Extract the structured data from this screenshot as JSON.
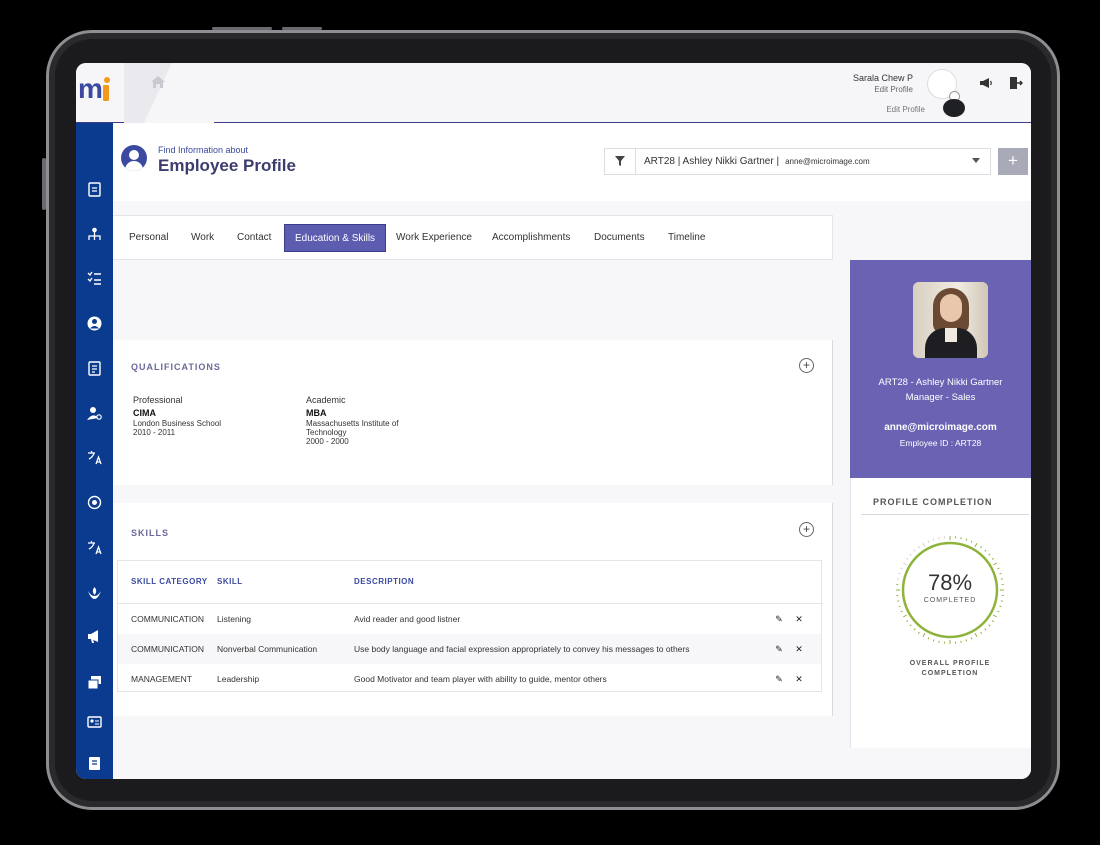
{
  "header": {
    "user_name": "Sarala Chew P",
    "edit_profile": "Edit Profile",
    "edit_profile_echo": "Edit Profile"
  },
  "page": {
    "subtitle": "Find Information about",
    "title": "Employee Profile"
  },
  "employee_select": {
    "value": "ART28 | Ashley Nikki Gartner |",
    "email": "anne@microimage.com",
    "add_label": "+"
  },
  "tabs": [
    {
      "label": "Personal"
    },
    {
      "label": "Work"
    },
    {
      "label": "Contact"
    },
    {
      "label": "Education & Skills",
      "active": true
    },
    {
      "label": "Work Experience"
    },
    {
      "label": "Accomplishments"
    },
    {
      "label": "Documents"
    },
    {
      "label": "Timeline"
    }
  ],
  "qualifications": {
    "title": "QUALIFICATIONS",
    "add_label": "+",
    "items": [
      {
        "type": "Professional",
        "degree": "CIMA",
        "institution": "London Business School",
        "years": "2010 - 2011"
      },
      {
        "type": "Academic",
        "degree": "MBA",
        "institution": "Massachusetts Institute of Technology",
        "years": "2000 - 2000"
      }
    ]
  },
  "skills": {
    "title": "SKILLS",
    "add_label": "+",
    "columns": [
      "SKILL CATEGORY",
      "SKILL",
      "DESCRIPTION"
    ],
    "rows": [
      {
        "category": "COMMUNICATION",
        "skill": "Listening",
        "description": "Avid reader and good listner"
      },
      {
        "category": "COMMUNICATION",
        "skill": "Nonverbal Communication",
        "description": "Use body language and facial expression appropriately to convey his messages to others"
      },
      {
        "category": "MANAGEMENT",
        "skill": "Leadership",
        "description": "Good Motivator and team player with ability to guide, mentor others"
      }
    ],
    "edit_glyph": "✎",
    "delete_glyph": "✕"
  },
  "profile_card": {
    "name": "ART28 - Ashley Nikki Gartner",
    "role": "Manager - Sales",
    "email": "anne@microimage.com",
    "employee_id": "Employee ID : ART28"
  },
  "profile_completion": {
    "title": "PROFILE COMPLETION",
    "percent": 78,
    "percent_label": "78%",
    "completed_label": "COMPLETED",
    "overall_label": "OVERALL PROFILE COMPLETION"
  },
  "colors": {
    "sidebar": "#0b3b8f",
    "accent": "#5c5cb0",
    "panel": "#6a63b4",
    "gauge": "#8db33a"
  },
  "icons": {
    "sidebar": [
      "clipboard-icon",
      "org-chart-icon",
      "checklist-icon",
      "user-circle-icon",
      "form-icon",
      "user-settings-icon",
      "translate-icon",
      "badge-icon",
      "translate-icon",
      "lotus-icon",
      "megaphone-icon",
      "cards-icon",
      "id-card-icon",
      "document-icon",
      "list-icon"
    ]
  }
}
